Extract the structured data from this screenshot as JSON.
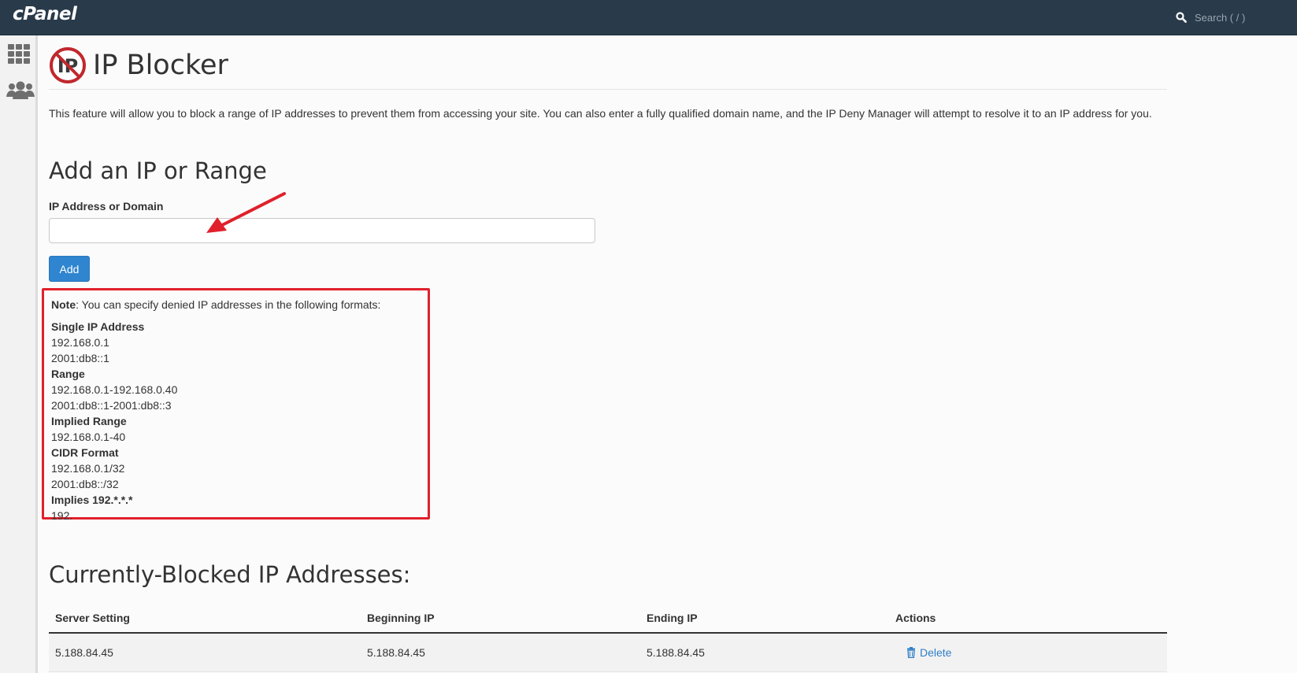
{
  "header": {
    "logo_text": "cPanel",
    "search_placeholder": "Search ( / )"
  },
  "sidebar": {
    "icons": [
      "apps-grid-icon",
      "users-icon"
    ]
  },
  "page": {
    "title": "IP Blocker",
    "description": "This feature will allow you to block a range of IP addresses to prevent them from accessing your site. You can also enter a fully qualified domain name, and the IP Deny Manager will attempt to resolve it to an IP address for you."
  },
  "add_form": {
    "heading": "Add an IP or Range",
    "field_label": "IP Address or Domain",
    "field_value": "",
    "button_label": "Add"
  },
  "note": {
    "prefix": "Note",
    "text": ": You can specify denied IP addresses in the following formats:",
    "sections": [
      {
        "title": "Single IP Address",
        "examples": [
          "192.168.0.1",
          "2001:db8::1"
        ]
      },
      {
        "title": "Range",
        "examples": [
          "192.168.0.1-192.168.0.40",
          "2001:db8::1-2001:db8::3"
        ]
      },
      {
        "title": "Implied Range",
        "examples": [
          "192.168.0.1-40"
        ]
      },
      {
        "title": "CIDR Format",
        "examples": [
          "192.168.0.1/32",
          "2001:db8::/32"
        ]
      },
      {
        "title": "Implies 192.*.*.*",
        "examples": [
          "192."
        ]
      }
    ]
  },
  "blocked": {
    "heading": "Currently-Blocked IP Addresses:",
    "columns": [
      "Server Setting",
      "Beginning IP",
      "Ending IP",
      "Actions"
    ],
    "rows": [
      {
        "server_setting": "5.188.84.45",
        "beginning_ip": "5.188.84.45",
        "ending_ip": "5.188.84.45",
        "action": "Delete"
      }
    ]
  },
  "colors": {
    "topbar": "#293a4a",
    "primary_button": "#2f85cf",
    "annotation_red": "#e0202b",
    "link": "#2f7fc7"
  }
}
